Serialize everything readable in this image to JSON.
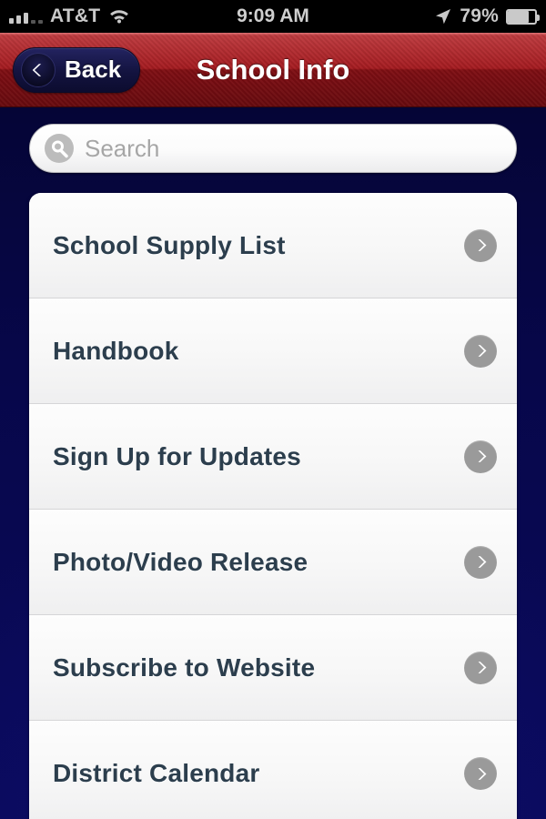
{
  "status_bar": {
    "signal_icon": "signal-bars-icon",
    "carrier": "AT&T",
    "wifi_icon": "wifi-icon",
    "time": "9:09 AM",
    "location_icon": "location-arrow-icon",
    "battery_percent": "79%",
    "battery_icon": "battery-icon",
    "battery_level": 75
  },
  "nav_bar": {
    "back_label": "Back",
    "back_icon": "chevron-left-icon",
    "title": "School Info",
    "background_color": "#a21419"
  },
  "search": {
    "icon": "search-icon",
    "value": "",
    "placeholder": "Search"
  },
  "list": {
    "disclosure_icon": "chevron-right-icon",
    "items": [
      {
        "label": "School Supply List"
      },
      {
        "label": "Handbook"
      },
      {
        "label": "Sign Up for Updates"
      },
      {
        "label": "Photo/Video Release"
      },
      {
        "label": "Subscribe to Website"
      },
      {
        "label": "District Calendar"
      }
    ]
  },
  "theme": {
    "background_color": "#07074a",
    "accent_color": "#a21419",
    "row_text_color": "#2c3e4d",
    "disclosure_color": "#9a9a9a"
  }
}
